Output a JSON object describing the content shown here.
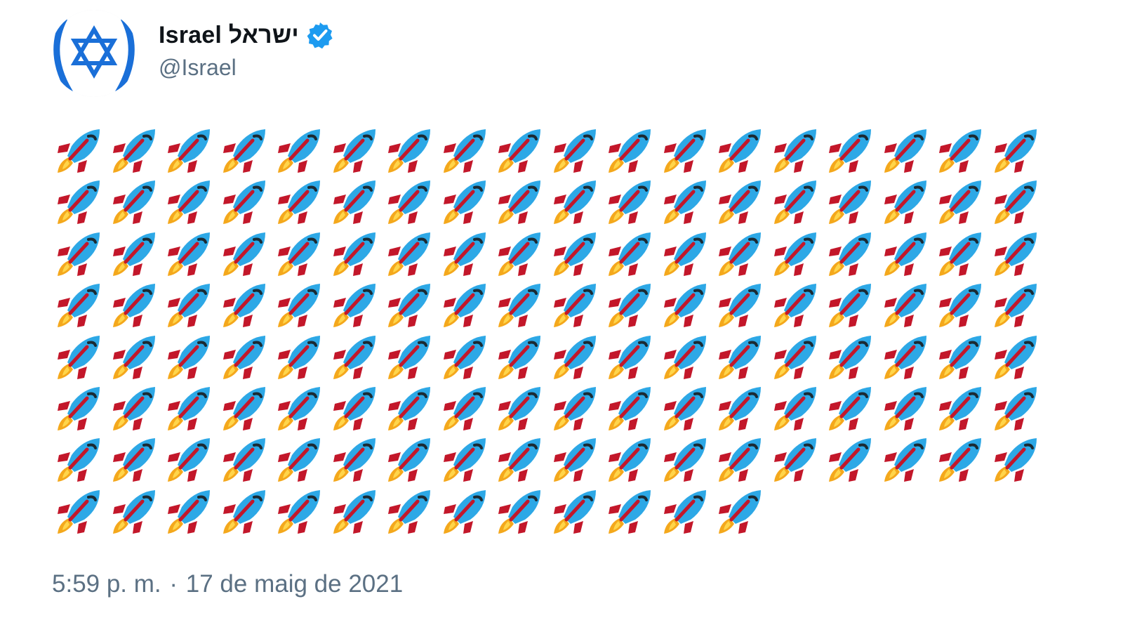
{
  "tweet": {
    "author": {
      "display_name": "Israel ישראל",
      "handle": "@Israel",
      "verified": true,
      "avatar_icon": "star-of-david-icon",
      "verified_icon": "verified-badge-icon"
    },
    "body": {
      "emoji": "🚀",
      "emoji_icon": "rocket-icon",
      "rocket_count": 139
    },
    "timestamp": {
      "time": "5:59 p. m.",
      "separator": "·",
      "date": "17 de maig de 2021"
    }
  },
  "colors": {
    "brand_blue": "#1d9bf0",
    "flag_blue": "#1a6fd8",
    "name_text": "#0f1419",
    "secondary_text": "#5b7083",
    "rocket_body": "#2da8e6",
    "rocket_fins": "#c3172a",
    "rocket_flame": "#f4a81c"
  }
}
